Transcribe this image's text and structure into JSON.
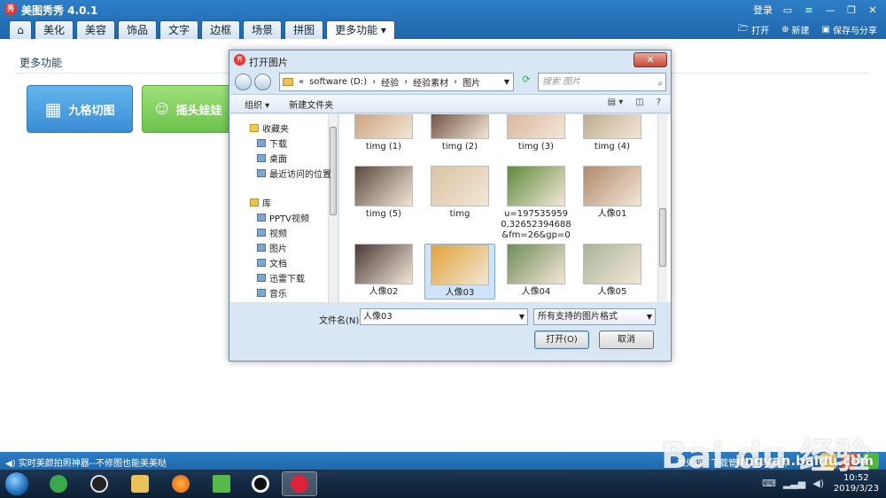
{
  "app": {
    "title": "美图秀秀 4.0.1",
    "login": "登录",
    "logo_text": "秀",
    "tabs": [
      "美化",
      "美容",
      "饰品",
      "文字",
      "边框",
      "场景",
      "拼图",
      "更多功能 ▾"
    ],
    "actions": {
      "open": "打开",
      "new": "新建",
      "save_share": "保存与分享"
    }
  },
  "main": {
    "section_title": "更多功能",
    "features": [
      "九格切图",
      "摇头娃娃"
    ]
  },
  "dialog": {
    "title": "打开图片",
    "close": "✕",
    "address": [
      "«",
      "software (D:)",
      "›",
      "经验",
      "›",
      "经验素材",
      "›",
      "图片"
    ],
    "search_placeholder": "搜索 图片",
    "toolbar": {
      "organize": "组织 ▾",
      "new_folder": "新建文件夹"
    },
    "tree": [
      {
        "label": "收藏夹",
        "kind": "star",
        "sub": false
      },
      {
        "label": "下载",
        "kind": "folder",
        "sub": true
      },
      {
        "label": "桌面",
        "kind": "folder",
        "sub": true
      },
      {
        "label": "最近访问的位置",
        "kind": "folder",
        "sub": true
      },
      {
        "label": "库",
        "kind": "lib",
        "sub": false
      },
      {
        "label": "PPTV视频",
        "kind": "folder",
        "sub": true
      },
      {
        "label": "视频",
        "kind": "folder",
        "sub": true
      },
      {
        "label": "图片",
        "kind": "folder",
        "sub": true
      },
      {
        "label": "文档",
        "kind": "folder",
        "sub": true
      },
      {
        "label": "迅雷下载",
        "kind": "folder",
        "sub": true
      },
      {
        "label": "音乐",
        "kind": "folder",
        "sub": true
      }
    ],
    "files": [
      {
        "name": "timg (1)",
        "color": "#c9a07a"
      },
      {
        "name": "timg (2)",
        "color": "#6b4c3b"
      },
      {
        "name": "timg (3)",
        "color": "#d8b59a"
      },
      {
        "name": "timg (4)",
        "color": "#b9a98c"
      },
      {
        "name": "timg (5)",
        "color": "#5a4a40"
      },
      {
        "name": "timg",
        "color": "#d9c4a3"
      },
      {
        "name": "u=1975359590,32652394688&fm=26&gp=0",
        "color": "#5e8b3c"
      },
      {
        "name": "人像01",
        "color": "#b08a6d"
      },
      {
        "name": "人像02",
        "color": "#4a3a38"
      },
      {
        "name": "人像03",
        "color": "#e0a33a",
        "selected": true
      },
      {
        "name": "人像04",
        "color": "#6f8c5a"
      },
      {
        "name": "人像05",
        "color": "#a8b59a"
      }
    ],
    "filename_label": "文件名(N):",
    "filename_value": "人像03",
    "filter": "所有支持的图片格式",
    "open_btn": "打开(O)",
    "cancel_btn": "取消"
  },
  "statusbar": {
    "left": "◀) 实时美颜拍照神器--不修图也能美美哒",
    "batch": "批处理",
    "download": "下载管理",
    "share": "分享图片"
  },
  "taskbar": {
    "time": "10:52",
    "date": "2019/3/23"
  },
  "watermark": {
    "main": "Bai du 经验",
    "sub": "jingyan.baidu.com"
  }
}
